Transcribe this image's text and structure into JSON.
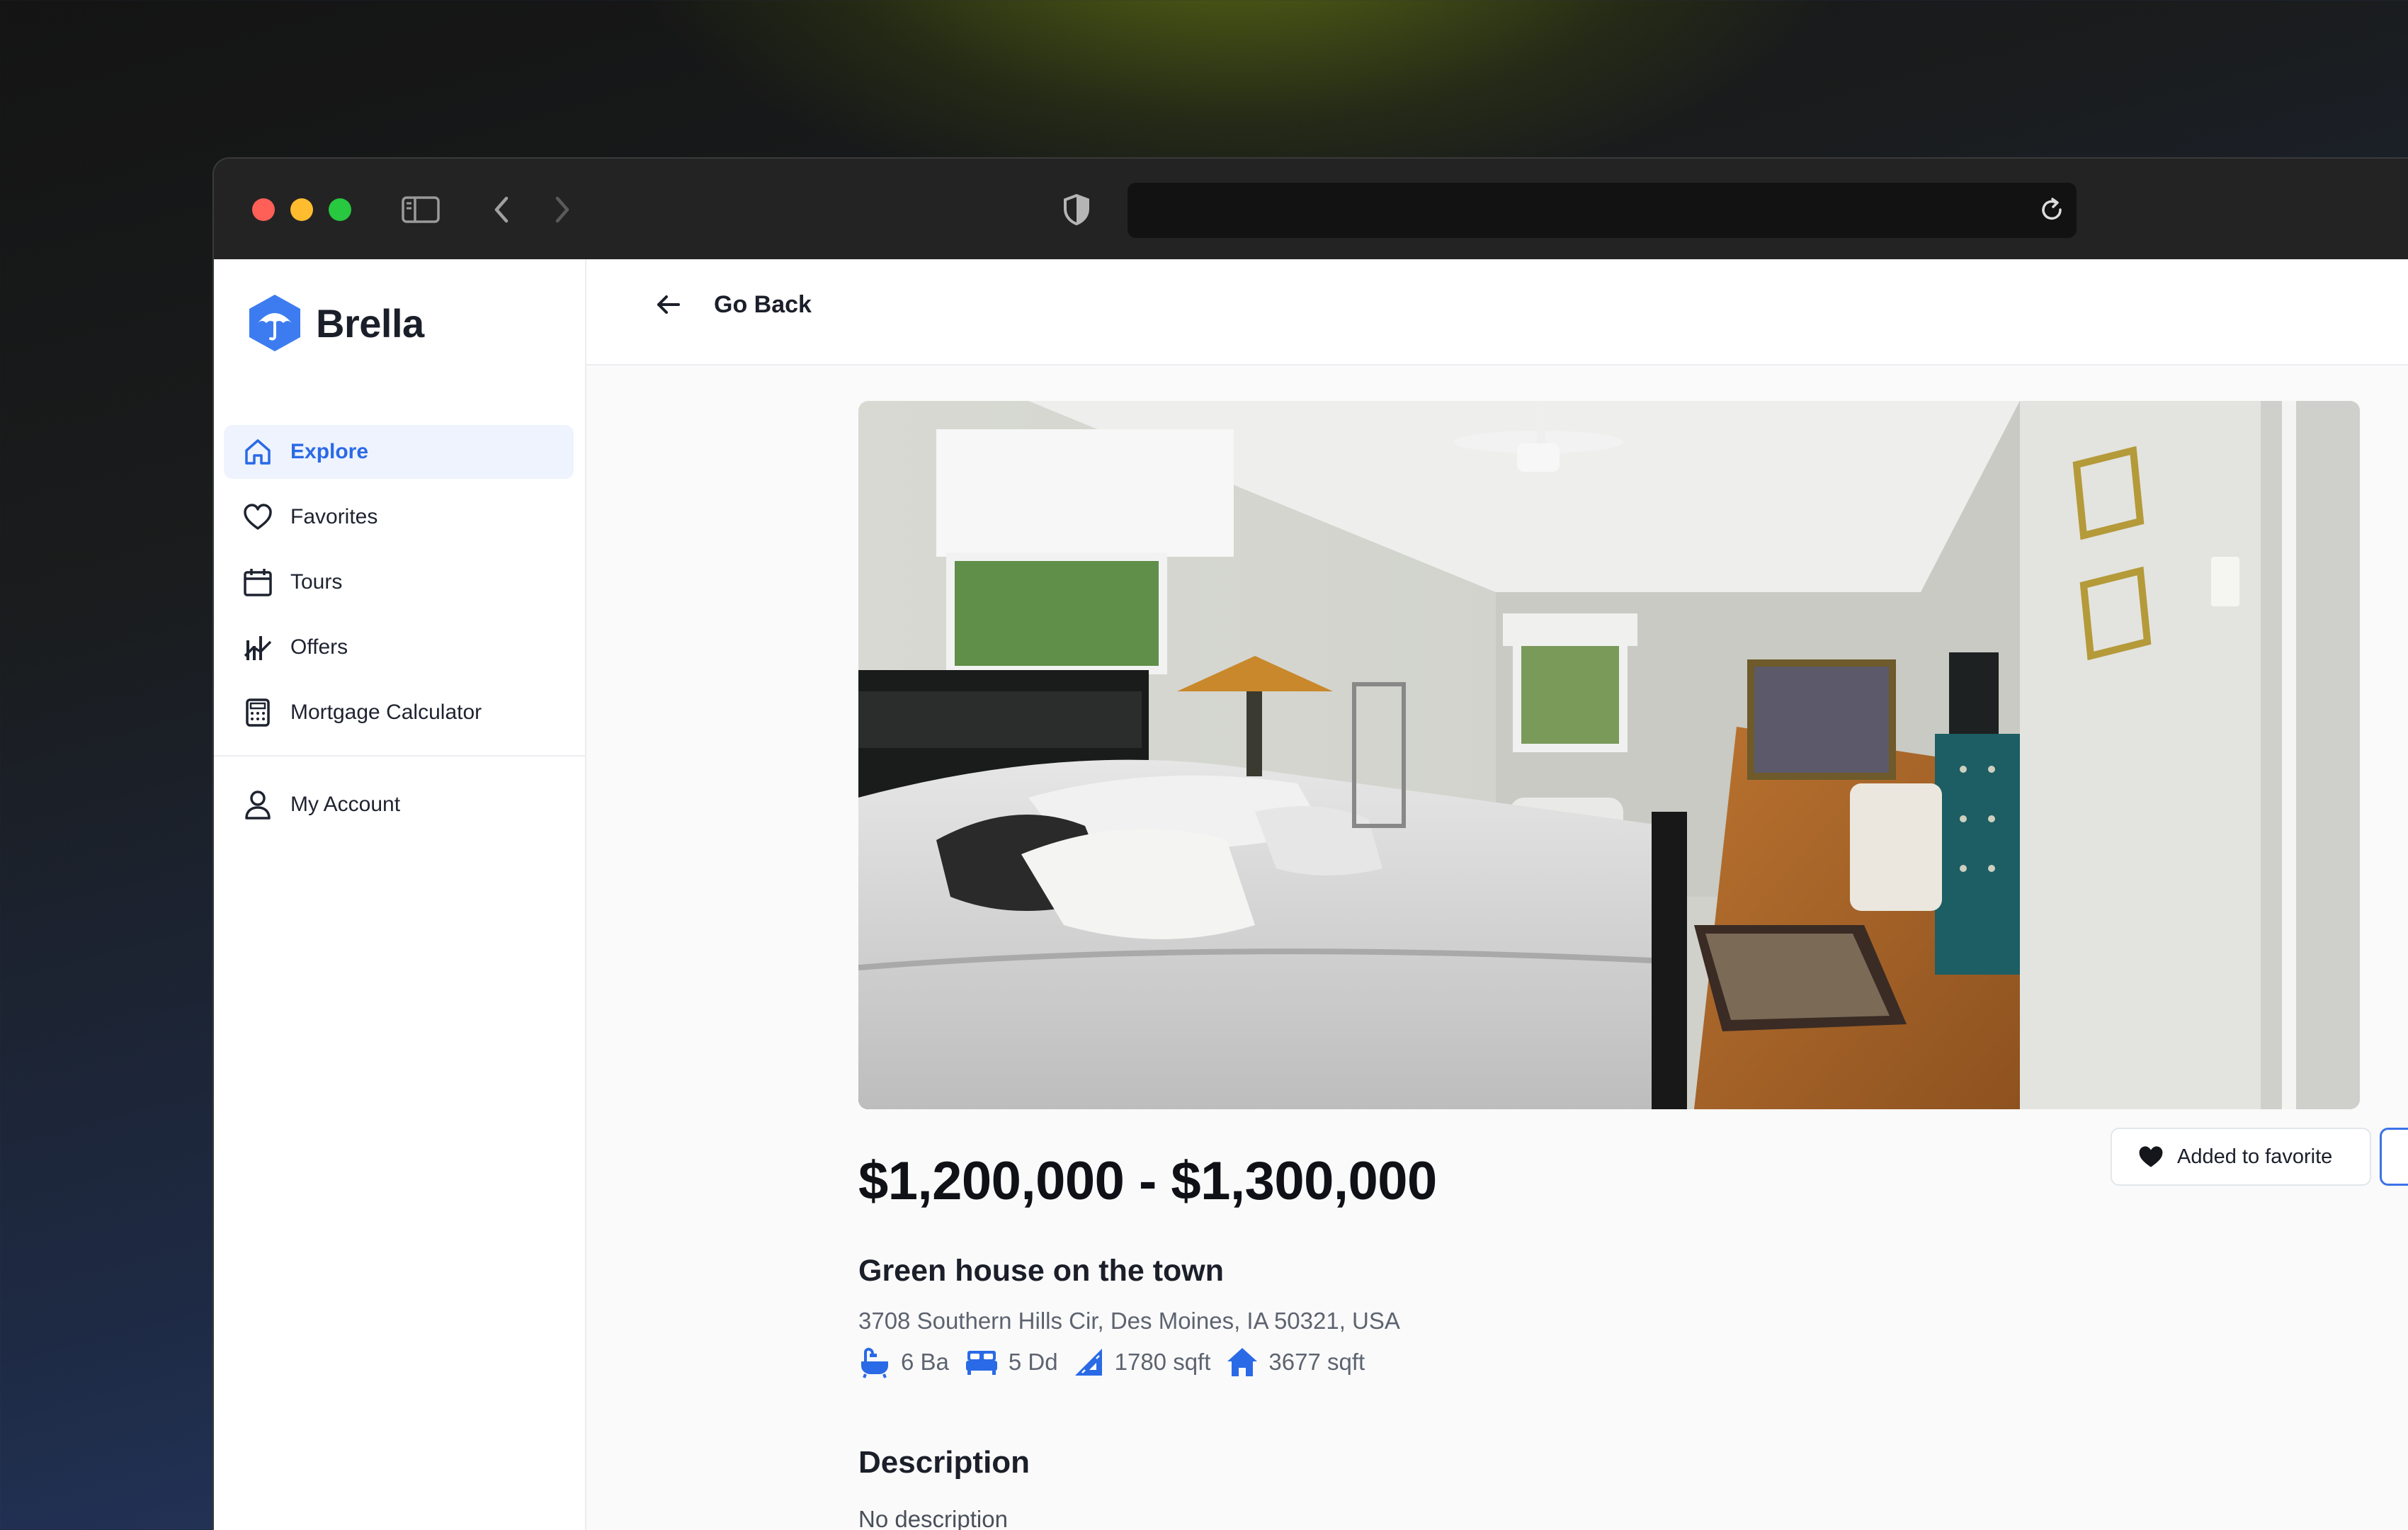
{
  "brand": {
    "name": "Brella",
    "color": "#2a6ae6"
  },
  "sidebar": {
    "items": [
      {
        "label": "Explore",
        "icon": "home-icon",
        "active": true
      },
      {
        "label": "Favorites",
        "icon": "heart-icon"
      },
      {
        "label": "Tours",
        "icon": "calendar-icon"
      },
      {
        "label": "Offers",
        "icon": "offers-chart-icon"
      },
      {
        "label": "Mortgage Calculator",
        "icon": "calculator-icon"
      }
    ],
    "account": {
      "label": "My Account",
      "icon": "user-icon"
    }
  },
  "header": {
    "back_label": "Go Back"
  },
  "listing": {
    "price": "$1,200,000 - $1,300,000",
    "title": "Green house on the town",
    "address": "3708 Southern Hills Cir, Des Moines, IA 50321, USA",
    "specs": [
      {
        "icon": "bathtub-icon",
        "text": "6 Ba"
      },
      {
        "icon": "bed-icon",
        "text": "5 Dd"
      },
      {
        "icon": "ruler-icon",
        "text": "1780 sqft"
      },
      {
        "icon": "house-icon",
        "text": "3677 sqft"
      }
    ],
    "favorite_label": "Added to favorite",
    "description_heading": "Description",
    "description": "No description"
  }
}
